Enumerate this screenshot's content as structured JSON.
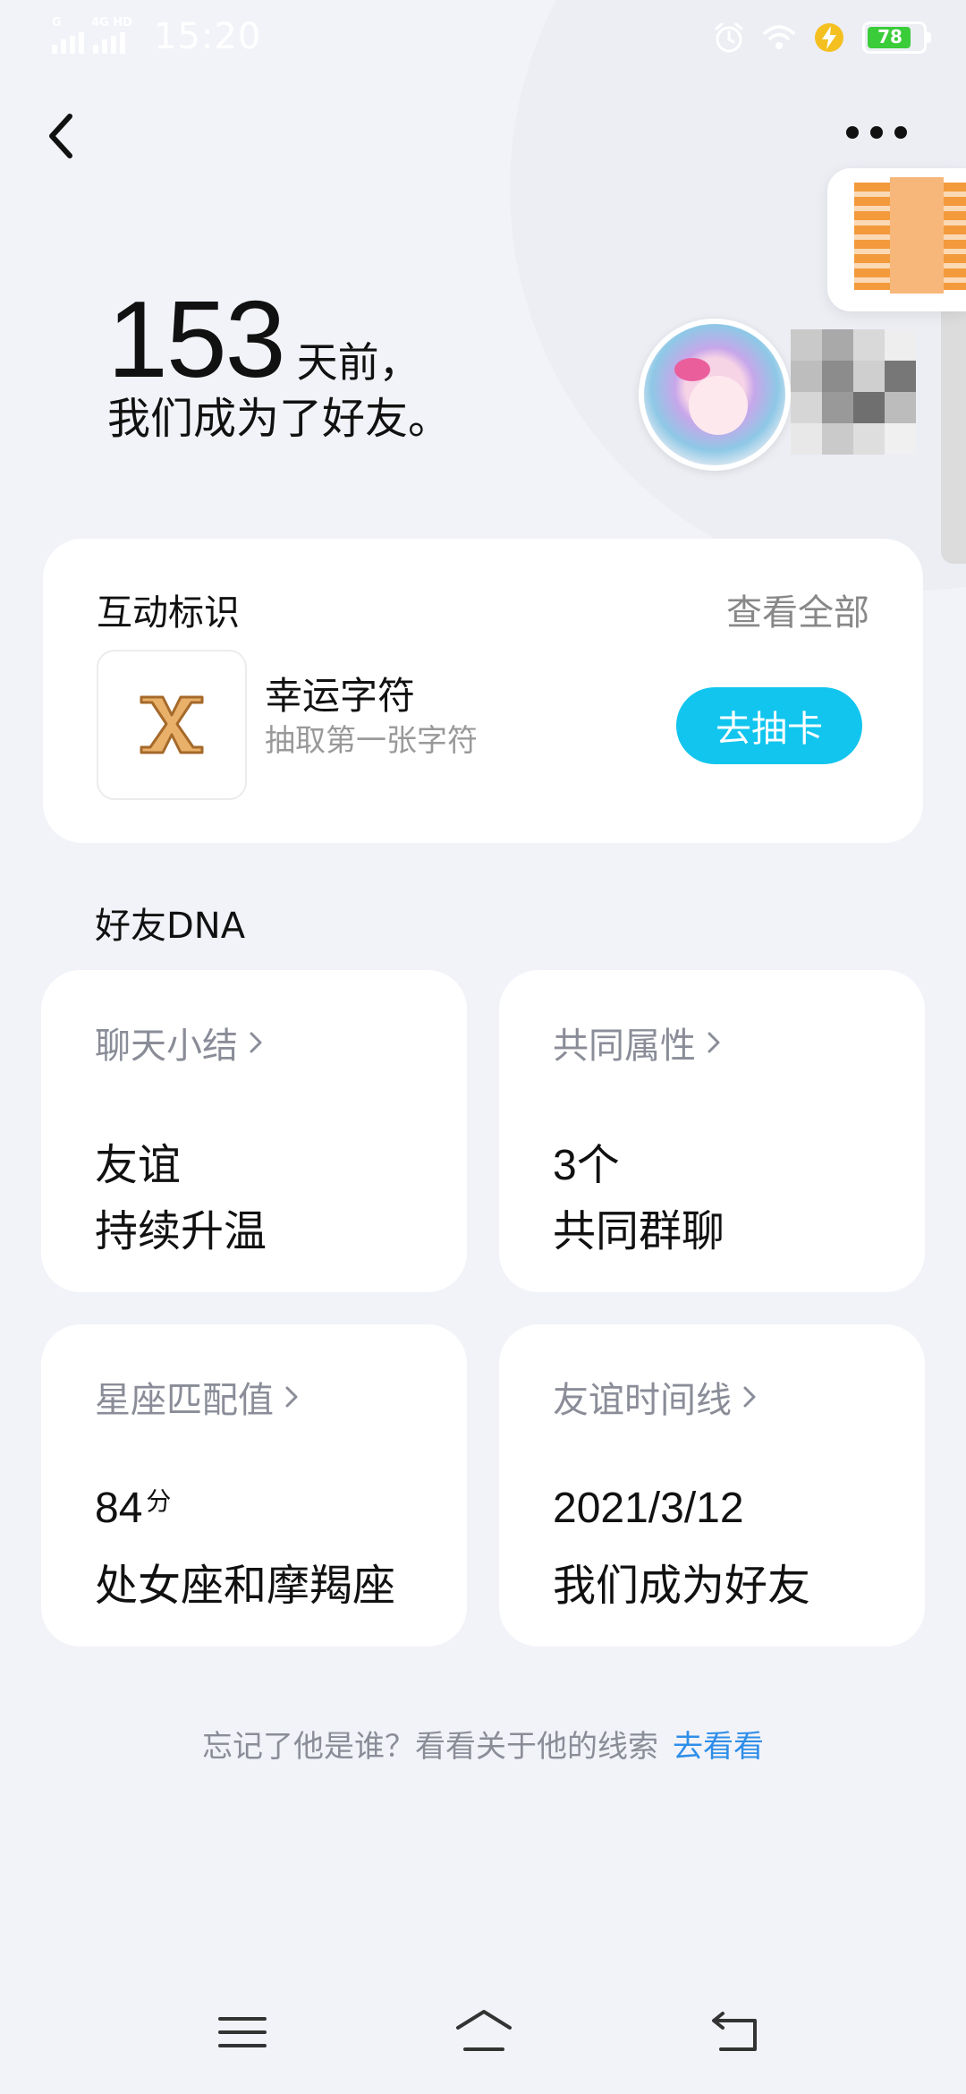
{
  "status_bar": {
    "time": "15:20",
    "network_left": "G",
    "network_right": "4G HD",
    "battery": "78"
  },
  "header": {
    "days": "153",
    "days_suffix": "天前，",
    "subtitle": "我们成为了好友。"
  },
  "interaction": {
    "title": "互动标识",
    "view_all": "查看全部",
    "badge_letter": "X",
    "badge_name": "幸运字符",
    "badge_desc": "抽取第一张字符",
    "draw_button": "去抽卡"
  },
  "dna": {
    "title": "好友DNA",
    "cards": [
      {
        "title": "聊天小结",
        "line1": "友谊",
        "line2": "持续升温"
      },
      {
        "title": "共同属性",
        "line1": "3个",
        "line2": "共同群聊"
      },
      {
        "title": "星座匹配值",
        "line1": "84",
        "unit": "分",
        "line2": "处女座和摩羯座"
      },
      {
        "title": "友谊时间线",
        "line1": "2021/3/12",
        "line2": "我们成为好友"
      }
    ]
  },
  "hint": {
    "text": "忘记了他是谁？看看关于他的线索",
    "link": "去看看"
  },
  "colors": {
    "background": "#f2f3f8",
    "accent": "#12c5ee",
    "link": "#2f8ee8",
    "battery_green": "#3bcc3a",
    "badge_gold": "#c98a3c"
  },
  "icons": {
    "back": "chevron-left-icon",
    "more": "more-dots-icon",
    "alarm": "alarm-icon",
    "wifi": "wifi-icon",
    "charging": "charging-bolt-icon",
    "menu": "menu-icon",
    "home": "home-icon",
    "return": "return-icon"
  }
}
